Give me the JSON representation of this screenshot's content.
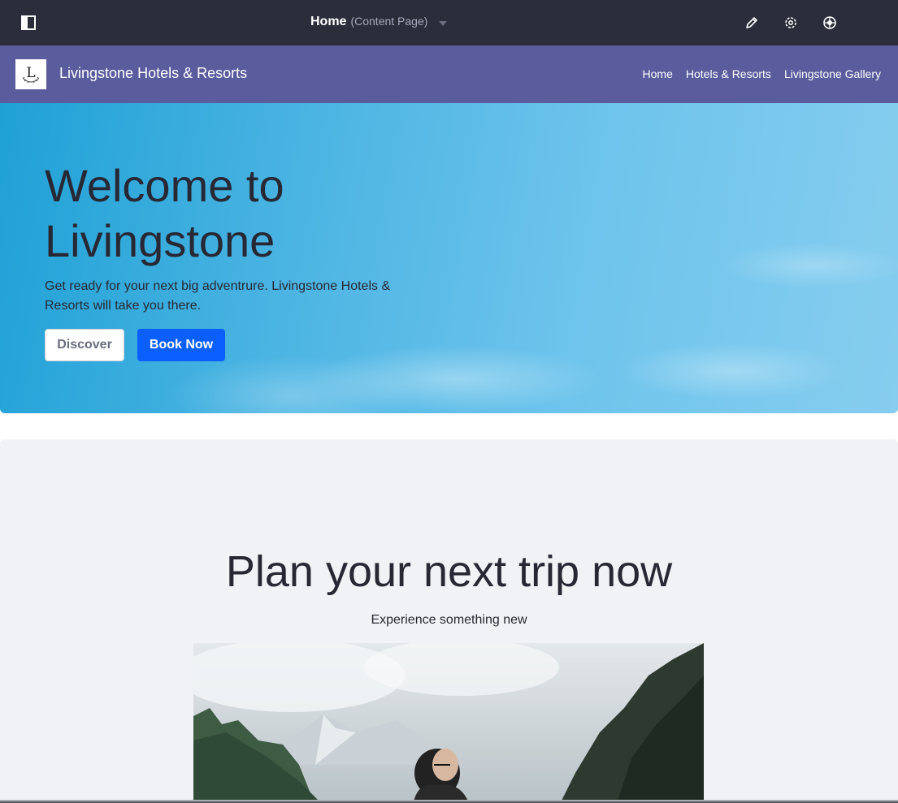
{
  "control_menu": {
    "title": "Home",
    "subtitle": "(Content Page)",
    "icons": [
      "sidebar-toggle-icon",
      "pencil-icon",
      "gear-icon",
      "simulation-icon"
    ]
  },
  "site": {
    "logo_letter": "L",
    "name": "Livingstone Hotels & Resorts",
    "nav": [
      "Home",
      "Hotels & Resorts",
      "Livingstone Gallery"
    ]
  },
  "hero": {
    "heading": "Welcome to Livingstone",
    "description": "Get ready for your next big adventrure. Livingstone Hotels & Resorts will take you there.",
    "discover_label": "Discover",
    "book_label": "Book Now"
  },
  "plan": {
    "heading": "Plan your next trip now",
    "subheading": "Experience something new"
  },
  "colors": {
    "control_menu_bg": "#2b2d3a",
    "header_bg": "#5a5c9e",
    "primary": "#0b5fff",
    "section_bg": "#f1f2f5"
  }
}
